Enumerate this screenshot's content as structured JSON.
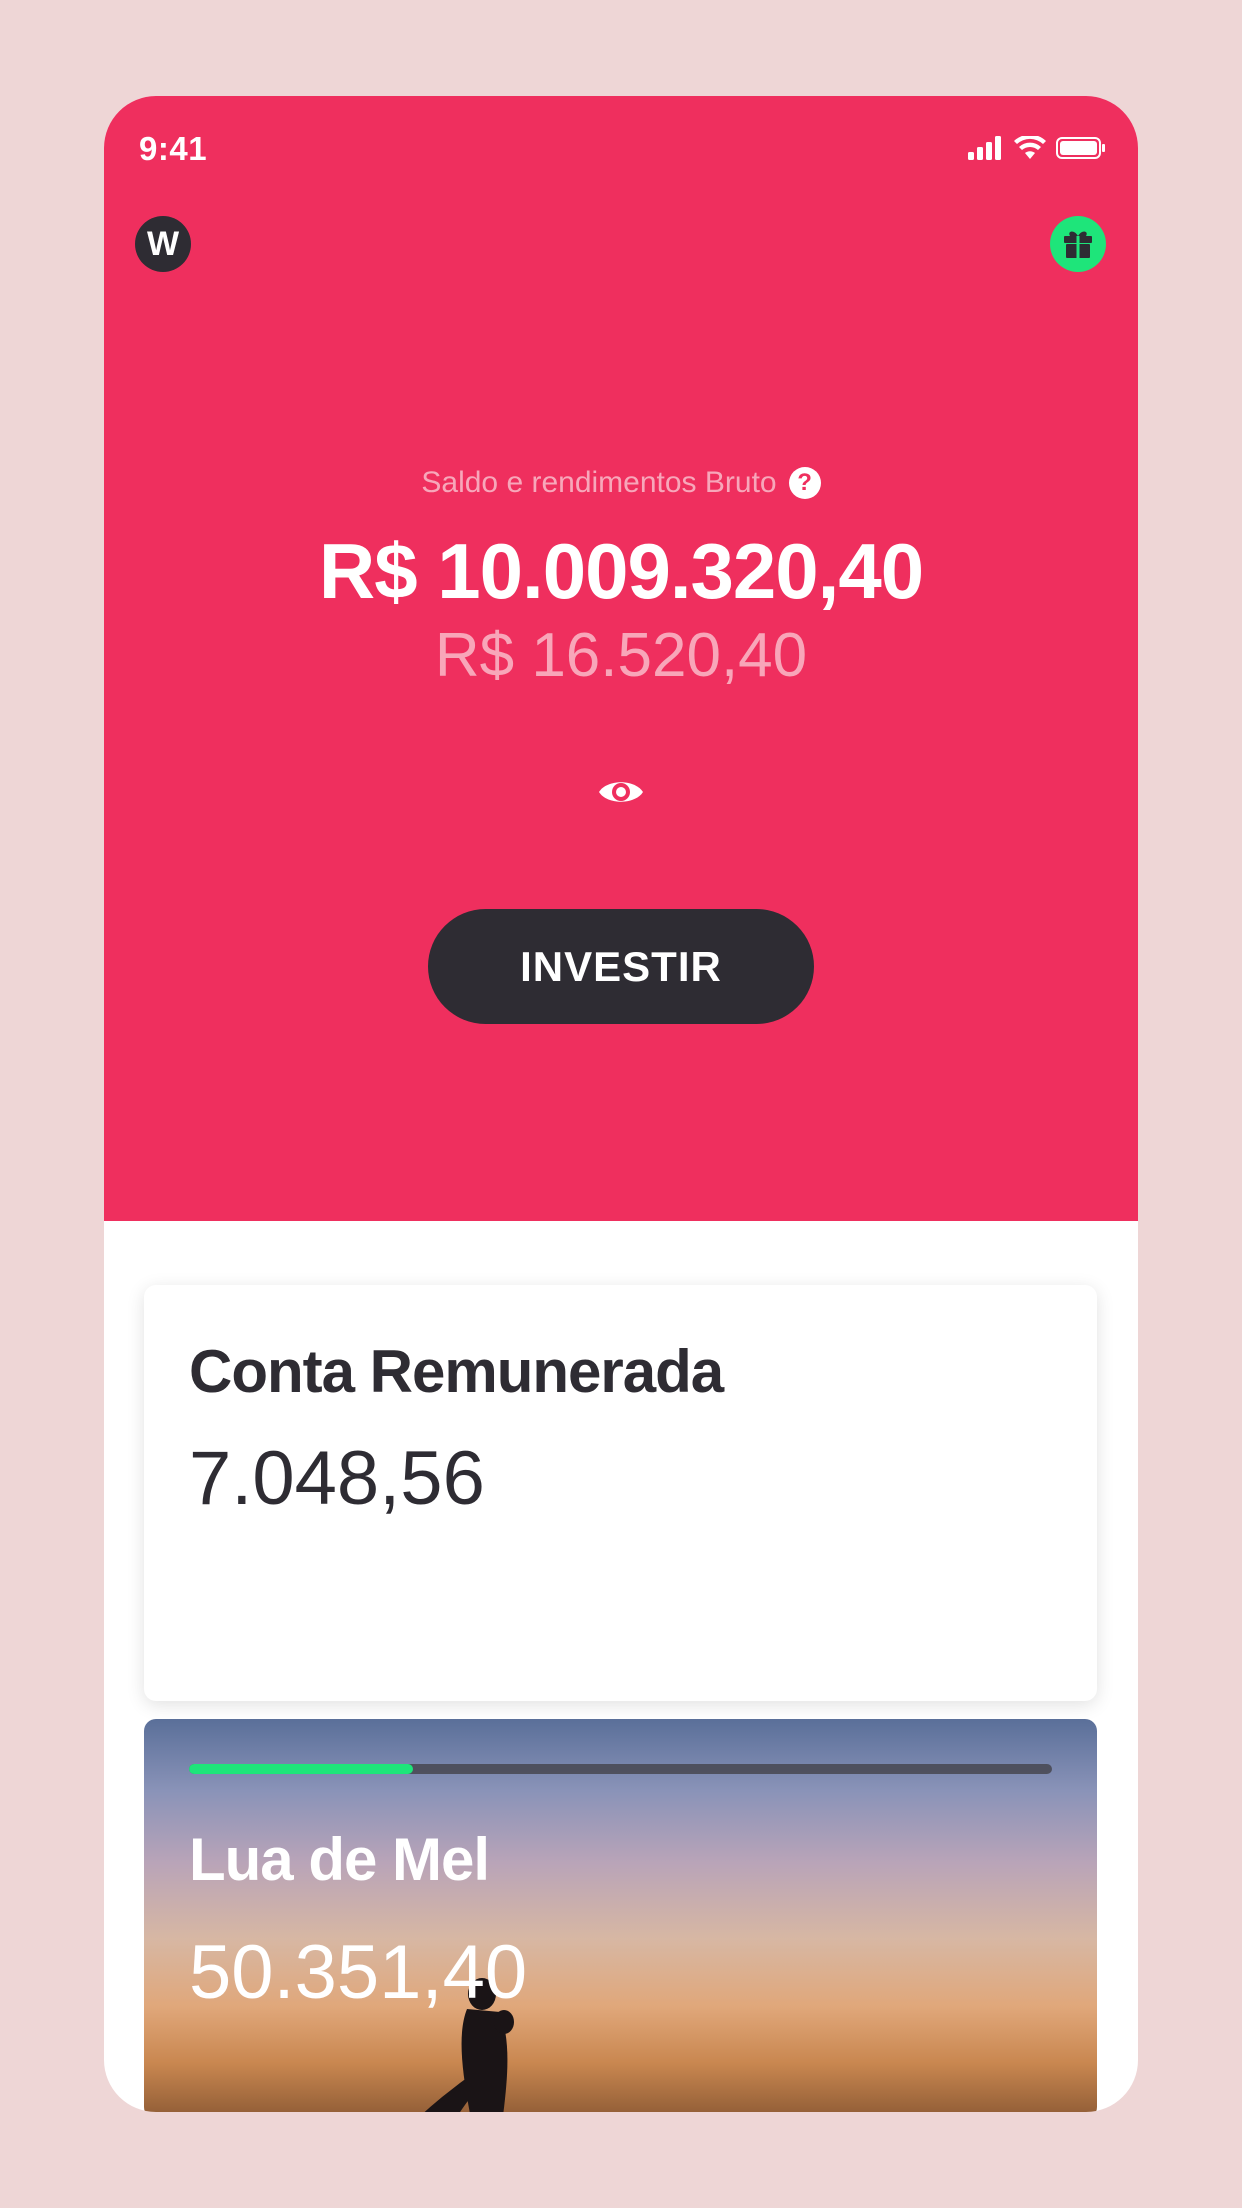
{
  "status_bar": {
    "time": "9:41"
  },
  "header": {
    "avatar_letter": "W",
    "avatar_icon": "user-initial-avatar",
    "gift_icon": "gift-icon",
    "gift_color": "#1ee57a"
  },
  "balance": {
    "label": "Saldo e rendimentos Bruto",
    "help_symbol": "?",
    "main_value": "R$ 10.009.320,40",
    "secondary_value": "R$ 16.520,40",
    "visibility_icon": "eye-icon"
  },
  "actions": {
    "invest_label": "INVESTIR"
  },
  "cards": [
    {
      "title": "Conta Remunerada",
      "value": "7.048,56"
    },
    {
      "title": "Lua de Mel",
      "value": "50.351,40",
      "progress": 0.26,
      "background": "sunset-couple-photo"
    }
  ],
  "colors": {
    "brand_pink": "#ef2f5e",
    "dark": "#2e2c33",
    "accent_green": "#1ee57a",
    "page_background": "#eed6d6"
  }
}
